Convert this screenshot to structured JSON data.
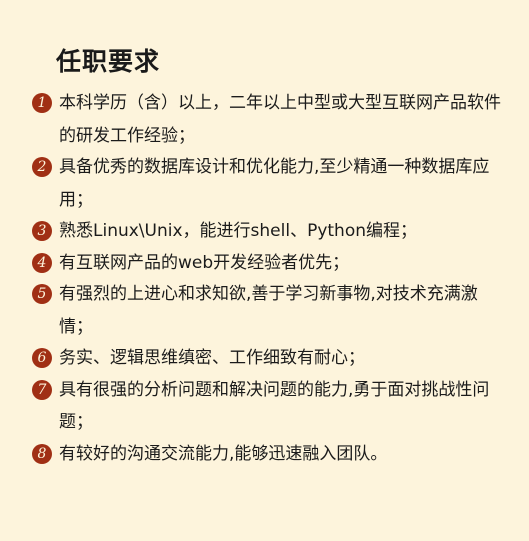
{
  "section": {
    "title": "任职要求"
  },
  "requirements": [
    {
      "number": "1",
      "text": "本科学历（含）以上，二年以上中型或大型互联网产品软件的研发工作经验；"
    },
    {
      "number": "2",
      "text": "具备优秀的数据库设计和优化能力,至少精通一种数据库应用；"
    },
    {
      "number": "3",
      "text": "熟悉Linux\\Unix，能进行shell、Python编程；"
    },
    {
      "number": "4",
      "text": "有互联网产品的web开发经验者优先；"
    },
    {
      "number": "5",
      "text": "有强烈的上进心和求知欲,善于学习新事物,对技术充满激情；"
    },
    {
      "number": "6",
      "text": "务实、逻辑思维缜密、工作细致有耐心；"
    },
    {
      "number": "7",
      "text": "具有很强的分析问题和解决问题的能力,勇于面对挑战性问题；"
    },
    {
      "number": "8",
      "text": "有较好的沟通交流能力,能够迅速融入团队。"
    }
  ],
  "colors": {
    "background": "#fdf4dc",
    "badge": "#a02f14",
    "text": "#1b1b1b"
  }
}
